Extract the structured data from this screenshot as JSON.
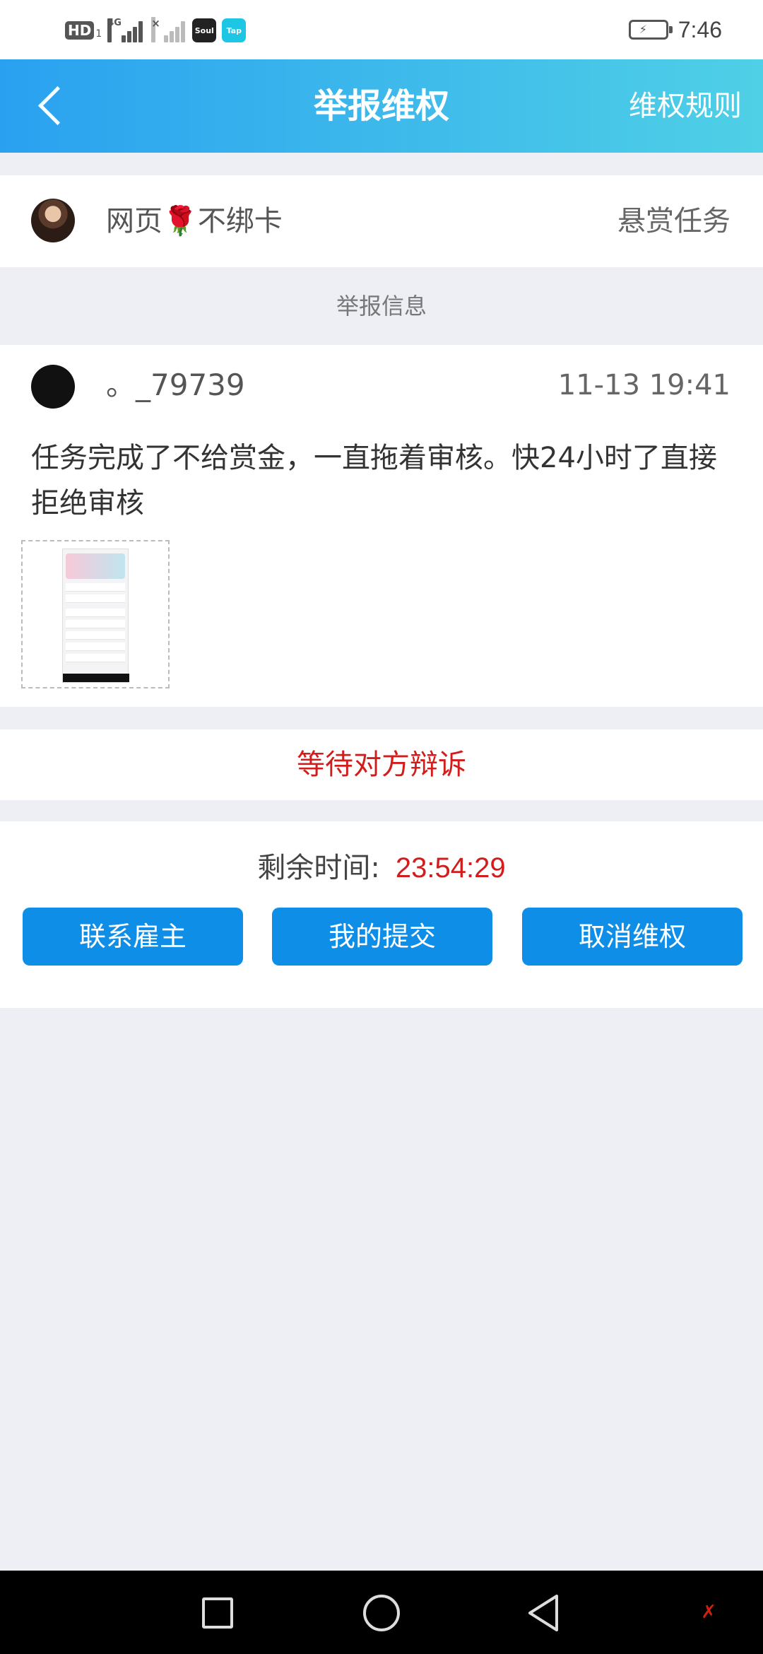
{
  "status_bar": {
    "hd": "HD",
    "sim": "1",
    "net": "4G",
    "apps": [
      "Soul",
      "Tap"
    ],
    "time": "7:46"
  },
  "header": {
    "title": "举报维权",
    "rules_link": "维权规则"
  },
  "task": {
    "name": "网页",
    "emoji": "🌹",
    "name_suffix": "不绑卡",
    "type": "悬赏任务"
  },
  "section_label": "举报信息",
  "report": {
    "username": "。_79739",
    "timestamp": "11-13 19:41",
    "content": "任务完成了不给赏金，一直拖着审核。快24小时了直接拒绝审核"
  },
  "status": "等待对方辩诉",
  "remaining": {
    "label": "剩余时间:",
    "value": "23:54:29"
  },
  "buttons": {
    "contact": "联系雇主",
    "my_submission": "我的提交",
    "cancel": "取消维权"
  },
  "colors": {
    "header_gradient_start": "#2aa1f0",
    "header_gradient_end": "#4fd0e6",
    "button_blue": "#0f8ee8",
    "alert_red": "#d21d1d"
  }
}
